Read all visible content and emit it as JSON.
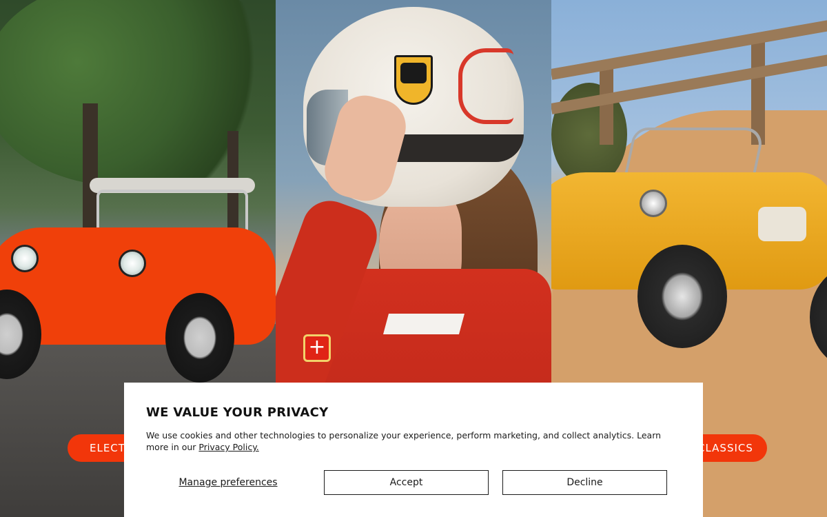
{
  "hero": {
    "panels": [
      {
        "name": "electric-buggy-street-photo"
      },
      {
        "name": "helmet-person-photo"
      },
      {
        "name": "classic-buggy-sand-photo"
      }
    ],
    "left_pill_label": "ELECTRIC",
    "right_pill_label": "CLASSICS"
  },
  "cookie_banner": {
    "title": "WE VALUE YOUR PRIVACY",
    "body": "We use cookies and other technologies to personalize your experience, perform marketing, and collect analytics. Learn more in our ",
    "policy_link": "Privacy Policy.",
    "manage_label": "Manage preferences",
    "accept_label": "Accept",
    "decline_label": "Decline"
  },
  "colors": {
    "accent": "#f2360a",
    "modal_bg": "#ffffff",
    "text": "#1a1a1a"
  }
}
